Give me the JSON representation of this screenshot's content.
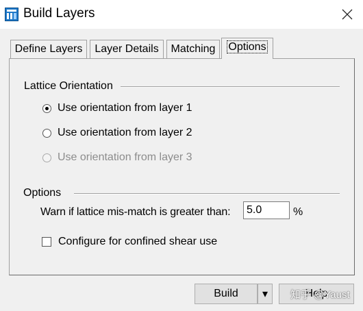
{
  "window": {
    "title": "Build Layers"
  },
  "tabs": [
    {
      "label": "Define Layers"
    },
    {
      "label": "Layer Details"
    },
    {
      "label": "Matching"
    },
    {
      "label": "Options"
    }
  ],
  "lattice": {
    "group_label": "Lattice Orientation",
    "options": [
      {
        "label": "Use orientation from layer 1",
        "checked": true,
        "enabled": true
      },
      {
        "label": "Use orientation from layer 2",
        "checked": false,
        "enabled": true
      },
      {
        "label": "Use orientation from layer 3",
        "checked": false,
        "enabled": false
      }
    ]
  },
  "options": {
    "group_label": "Options",
    "warn_label": "Warn if lattice mis-match is greater than:",
    "warn_value": "5.0",
    "warn_unit": "%",
    "confined_shear_label": "Configure for confined shear use",
    "confined_shear_checked": false
  },
  "buttons": {
    "build": "Build",
    "dropdown": "▾",
    "help": "Help"
  },
  "watermark": "知乎 @Yaust"
}
